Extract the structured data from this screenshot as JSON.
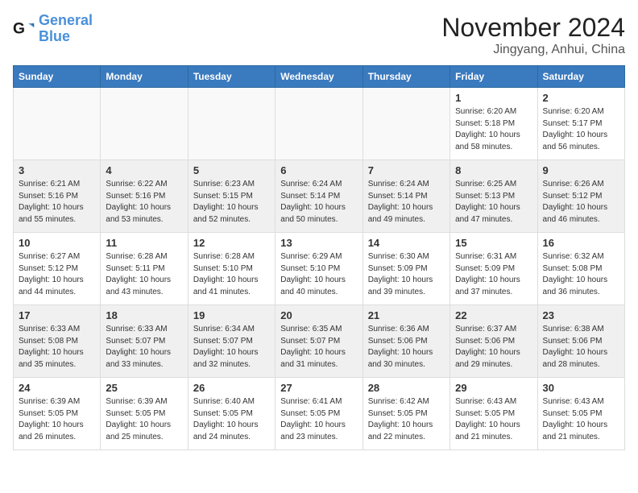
{
  "header": {
    "logo_line1": "General",
    "logo_line2": "Blue",
    "month_title": "November 2024",
    "location": "Jingyang, Anhui, China"
  },
  "weekdays": [
    "Sunday",
    "Monday",
    "Tuesday",
    "Wednesday",
    "Thursday",
    "Friday",
    "Saturday"
  ],
  "weeks": [
    [
      {
        "day": "",
        "info": ""
      },
      {
        "day": "",
        "info": ""
      },
      {
        "day": "",
        "info": ""
      },
      {
        "day": "",
        "info": ""
      },
      {
        "day": "",
        "info": ""
      },
      {
        "day": "1",
        "info": "Sunrise: 6:20 AM\nSunset: 5:18 PM\nDaylight: 10 hours\nand 58 minutes."
      },
      {
        "day": "2",
        "info": "Sunrise: 6:20 AM\nSunset: 5:17 PM\nDaylight: 10 hours\nand 56 minutes."
      }
    ],
    [
      {
        "day": "3",
        "info": "Sunrise: 6:21 AM\nSunset: 5:16 PM\nDaylight: 10 hours\nand 55 minutes."
      },
      {
        "day": "4",
        "info": "Sunrise: 6:22 AM\nSunset: 5:16 PM\nDaylight: 10 hours\nand 53 minutes."
      },
      {
        "day": "5",
        "info": "Sunrise: 6:23 AM\nSunset: 5:15 PM\nDaylight: 10 hours\nand 52 minutes."
      },
      {
        "day": "6",
        "info": "Sunrise: 6:24 AM\nSunset: 5:14 PM\nDaylight: 10 hours\nand 50 minutes."
      },
      {
        "day": "7",
        "info": "Sunrise: 6:24 AM\nSunset: 5:14 PM\nDaylight: 10 hours\nand 49 minutes."
      },
      {
        "day": "8",
        "info": "Sunrise: 6:25 AM\nSunset: 5:13 PM\nDaylight: 10 hours\nand 47 minutes."
      },
      {
        "day": "9",
        "info": "Sunrise: 6:26 AM\nSunset: 5:12 PM\nDaylight: 10 hours\nand 46 minutes."
      }
    ],
    [
      {
        "day": "10",
        "info": "Sunrise: 6:27 AM\nSunset: 5:12 PM\nDaylight: 10 hours\nand 44 minutes."
      },
      {
        "day": "11",
        "info": "Sunrise: 6:28 AM\nSunset: 5:11 PM\nDaylight: 10 hours\nand 43 minutes."
      },
      {
        "day": "12",
        "info": "Sunrise: 6:28 AM\nSunset: 5:10 PM\nDaylight: 10 hours\nand 41 minutes."
      },
      {
        "day": "13",
        "info": "Sunrise: 6:29 AM\nSunset: 5:10 PM\nDaylight: 10 hours\nand 40 minutes."
      },
      {
        "day": "14",
        "info": "Sunrise: 6:30 AM\nSunset: 5:09 PM\nDaylight: 10 hours\nand 39 minutes."
      },
      {
        "day": "15",
        "info": "Sunrise: 6:31 AM\nSunset: 5:09 PM\nDaylight: 10 hours\nand 37 minutes."
      },
      {
        "day": "16",
        "info": "Sunrise: 6:32 AM\nSunset: 5:08 PM\nDaylight: 10 hours\nand 36 minutes."
      }
    ],
    [
      {
        "day": "17",
        "info": "Sunrise: 6:33 AM\nSunset: 5:08 PM\nDaylight: 10 hours\nand 35 minutes."
      },
      {
        "day": "18",
        "info": "Sunrise: 6:33 AM\nSunset: 5:07 PM\nDaylight: 10 hours\nand 33 minutes."
      },
      {
        "day": "19",
        "info": "Sunrise: 6:34 AM\nSunset: 5:07 PM\nDaylight: 10 hours\nand 32 minutes."
      },
      {
        "day": "20",
        "info": "Sunrise: 6:35 AM\nSunset: 5:07 PM\nDaylight: 10 hours\nand 31 minutes."
      },
      {
        "day": "21",
        "info": "Sunrise: 6:36 AM\nSunset: 5:06 PM\nDaylight: 10 hours\nand 30 minutes."
      },
      {
        "day": "22",
        "info": "Sunrise: 6:37 AM\nSunset: 5:06 PM\nDaylight: 10 hours\nand 29 minutes."
      },
      {
        "day": "23",
        "info": "Sunrise: 6:38 AM\nSunset: 5:06 PM\nDaylight: 10 hours\nand 28 minutes."
      }
    ],
    [
      {
        "day": "24",
        "info": "Sunrise: 6:39 AM\nSunset: 5:05 PM\nDaylight: 10 hours\nand 26 minutes."
      },
      {
        "day": "25",
        "info": "Sunrise: 6:39 AM\nSunset: 5:05 PM\nDaylight: 10 hours\nand 25 minutes."
      },
      {
        "day": "26",
        "info": "Sunrise: 6:40 AM\nSunset: 5:05 PM\nDaylight: 10 hours\nand 24 minutes."
      },
      {
        "day": "27",
        "info": "Sunrise: 6:41 AM\nSunset: 5:05 PM\nDaylight: 10 hours\nand 23 minutes."
      },
      {
        "day": "28",
        "info": "Sunrise: 6:42 AM\nSunset: 5:05 PM\nDaylight: 10 hours\nand 22 minutes."
      },
      {
        "day": "29",
        "info": "Sunrise: 6:43 AM\nSunset: 5:05 PM\nDaylight: 10 hours\nand 21 minutes."
      },
      {
        "day": "30",
        "info": "Sunrise: 6:43 AM\nSunset: 5:05 PM\nDaylight: 10 hours\nand 21 minutes."
      }
    ]
  ]
}
